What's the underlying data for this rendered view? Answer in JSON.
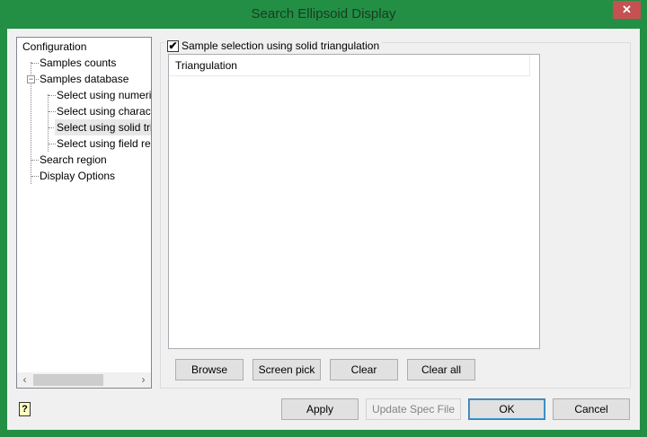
{
  "window": {
    "title": "Search Ellipsoid Display",
    "close_icon": "close-icon"
  },
  "tree": {
    "items": [
      {
        "label": "Configuration",
        "level": 0
      },
      {
        "label": "Samples counts",
        "level": 1
      },
      {
        "label": "Samples database",
        "level": 1,
        "expanded": true
      },
      {
        "label": "Select using numeric",
        "level": 2
      },
      {
        "label": "Select using character",
        "level": 2
      },
      {
        "label": "Select using solid triangulation",
        "level": 2,
        "selected": true
      },
      {
        "label": "Select using field restriction",
        "level": 2
      },
      {
        "label": "Search region",
        "level": 1
      },
      {
        "label": "Display Options",
        "level": 1
      }
    ]
  },
  "group": {
    "checkbox_label": "Sample selection using solid triangulation",
    "checked": true,
    "mark": "✔"
  },
  "list": {
    "column_header": "Triangulation",
    "rows": []
  },
  "list_buttons": {
    "browse": "Browse",
    "screen_pick": "Screen pick",
    "clear": "Clear",
    "clear_all": "Clear all"
  },
  "footer": {
    "apply": "Apply",
    "update_spec": "Update Spec File",
    "ok": "OK",
    "cancel": "Cancel",
    "help_glyph": "?"
  },
  "colors": {
    "title_bar": "#228f45",
    "close": "#c75050"
  }
}
